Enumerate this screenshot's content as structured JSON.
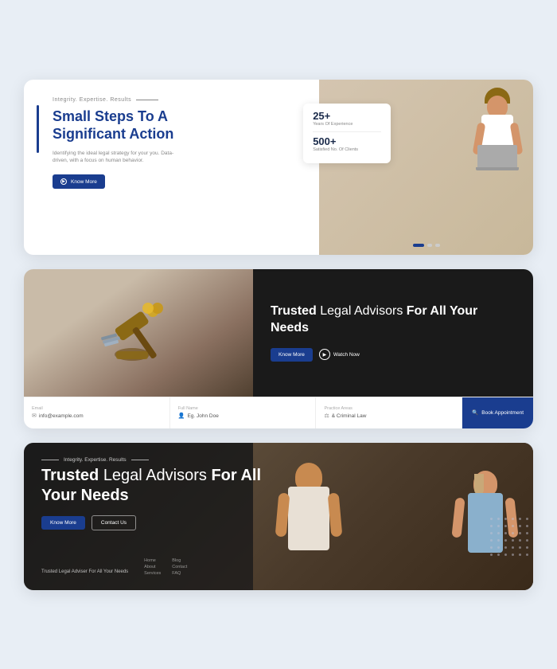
{
  "card1": {
    "tag": "Integrity. Expertise. Results",
    "heading_line1": "Small Steps To A",
    "heading_line2": "Significant Action",
    "description": "Identifying the ideal legal strategy for your you. Data-driven, with a focus on human behavior.",
    "cta_label": "Know More",
    "stat1_number": "25+",
    "stat1_label": "Years Of Experience",
    "stat2_number": "500+",
    "stat2_label": "Satisfied No. Of Clients",
    "dots": [
      "active",
      "",
      ""
    ]
  },
  "card2": {
    "heading": "Trusted Legal Advisors For All Your Needs",
    "cta_label": "Know More",
    "watch_label": "Watch Now",
    "field1_label": "Email",
    "field1_value": "info@example.com",
    "field2_label": "Full Name",
    "field2_value": "Eg. John Doe",
    "field3_label": "Practice Areas",
    "field3_value": "& Criminal Law",
    "book_label": "Book Appointment"
  },
  "card3": {
    "tag": "Integrity. Expertise. Results",
    "heading": "Trusted Legal Advisors For All Your Needs",
    "cta_label": "Know More",
    "contact_label": "Contact Us",
    "footer_title": "Trusted Legal Adviser For All Your Needs",
    "footer_links": [
      [
        "Home",
        "About",
        "Services"
      ],
      [
        "Blog",
        "Contact",
        "FAQ"
      ]
    ]
  },
  "icons": {
    "know_more": "▶",
    "play": "▶",
    "email": "✉",
    "person": "👤",
    "law": "⚖"
  }
}
